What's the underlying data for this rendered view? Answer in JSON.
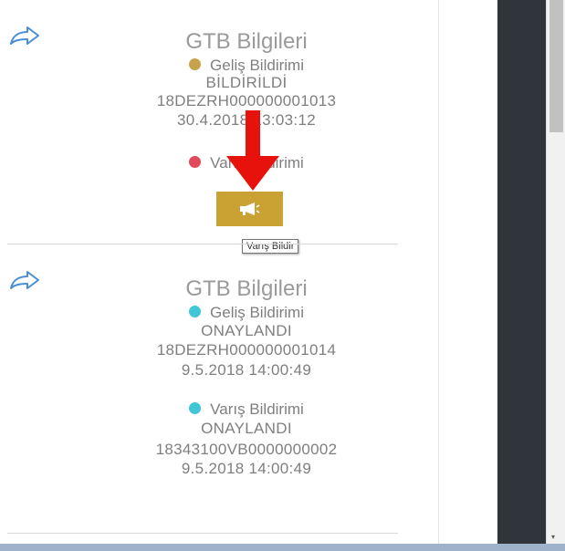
{
  "entries": [
    {
      "title": "GTB Bilgileri",
      "gelis": {
        "label": "Geliş Bildirimi",
        "status": "BİLDİRİLDİ",
        "code": "18DEZRH000000001013",
        "datetime": "30.4.2018 13:03:12",
        "dot_color": "#c5a24b"
      },
      "varis": {
        "label": "Varış Bildirimi",
        "dot_color": "#e04a5a"
      },
      "action": {
        "icon": "megaphone-icon",
        "tooltip": "Varış Bildir",
        "color": "#c9a233"
      }
    },
    {
      "title": "GTB Bilgileri",
      "gelis": {
        "label": "Geliş Bildirimi",
        "status": "ONAYLANDI",
        "code": "18DEZRH000000001014",
        "datetime": "9.5.2018 14:00:49",
        "dot_color": "#3fc7d6"
      },
      "varis": {
        "label": "Varış Bildirimi",
        "status": "ONAYLANDI",
        "code": "18343100VB0000000002",
        "datetime": "9.5.2018 14:00:49",
        "dot_color": "#3fc7d6"
      }
    }
  ],
  "colors": {
    "sidebar_dark": "#2f353b",
    "arrow_annotation": "#e8120c",
    "share_icon": "#4a8fd6"
  }
}
